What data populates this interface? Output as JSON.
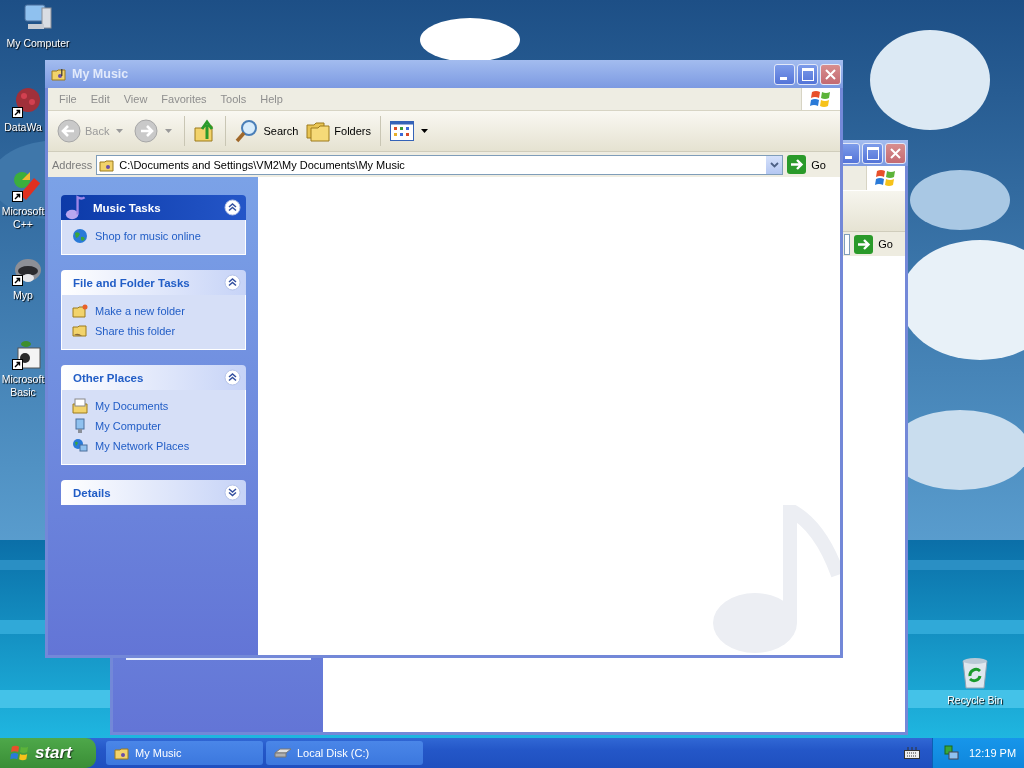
{
  "desktop_icons": [
    {
      "label": "My Computer",
      "kind": "computer",
      "shortcut": false
    },
    {
      "label": "DataWa",
      "kind": "dots",
      "shortcut": true
    },
    {
      "label": "Microsoft C++",
      "kind": "studio",
      "shortcut": true
    },
    {
      "label": "Myp",
      "kind": "animal",
      "shortcut": true
    },
    {
      "label": "Microsoft Basic",
      "kind": "basic",
      "shortcut": true
    }
  ],
  "recycle_bin": {
    "label": "Recycle Bin"
  },
  "back_window": {
    "go_label": "Go"
  },
  "window": {
    "title": "My Music",
    "menu": [
      "File",
      "Edit",
      "View",
      "Favorites",
      "Tools",
      "Help"
    ],
    "toolbar": [
      {
        "kind": "back",
        "label": "Back",
        "disabled": true
      },
      {
        "kind": "forward",
        "disabled": true
      },
      {
        "kind": "up"
      },
      {
        "kind": "search",
        "label": "Search"
      },
      {
        "kind": "folders",
        "label": "Folders"
      },
      {
        "kind": "views"
      }
    ],
    "address": {
      "label": "Address",
      "value": "C:\\Documents and Settings\\VM2\\My Documents\\My Music",
      "go_label": "Go"
    },
    "task_panes": [
      {
        "title": "Music Tasks",
        "kind": "special",
        "expanded": true,
        "links": [
          {
            "label": "Shop for music online",
            "kind": "globe"
          }
        ]
      },
      {
        "title": "File and Folder Tasks",
        "kind": "normal",
        "expanded": true,
        "links": [
          {
            "label": "Make a new folder",
            "kind": "new-folder"
          },
          {
            "label": "Share this folder",
            "kind": "share-folder"
          }
        ]
      },
      {
        "title": "Other Places",
        "kind": "normal",
        "expanded": true,
        "links": [
          {
            "label": "My Documents",
            "kind": "documents"
          },
          {
            "label": "My Computer",
            "kind": "computer"
          },
          {
            "label": "My Network Places",
            "kind": "network"
          }
        ]
      },
      {
        "title": "Details",
        "kind": "normal",
        "expanded": false
      }
    ]
  },
  "taskbar": {
    "start": "start",
    "buttons": [
      {
        "label": "My Music",
        "kind": "music-folder"
      },
      {
        "label": "Local Disk (C:)",
        "kind": "disk"
      }
    ],
    "clock": "12:19 PM"
  }
}
